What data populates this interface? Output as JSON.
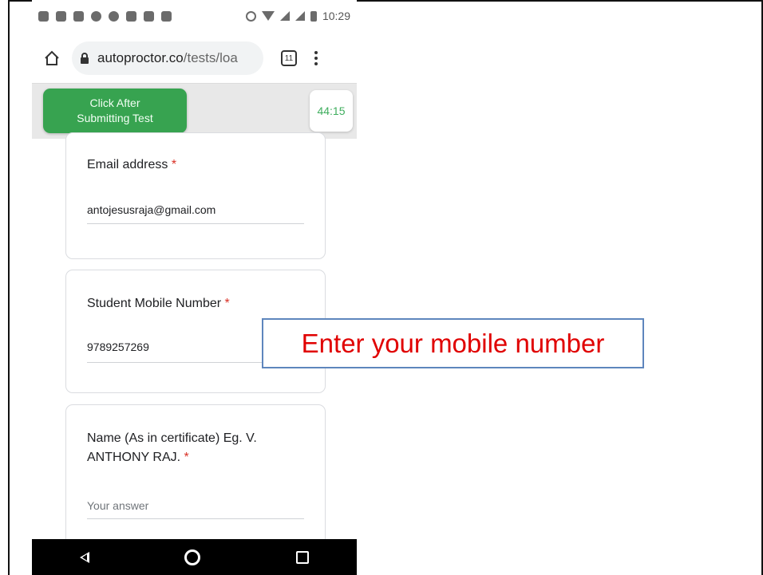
{
  "status_bar": {
    "time": "10:29"
  },
  "browser": {
    "url_host": "autoproctor.co",
    "url_path": "/tests/loa",
    "tab_count": "11"
  },
  "proctor": {
    "submit_label_line1": "Click After",
    "submit_label_line2": "Submitting Test",
    "timer": "44:15",
    "accent_color": "#37a350"
  },
  "form": {
    "fields": [
      {
        "label": "Email address",
        "required_mark": "*",
        "value": "antojesusraja@gmail.com"
      },
      {
        "label": "Student Mobile Number",
        "required_mark": "*",
        "value": "9789257269"
      },
      {
        "label_line1": "Name (As in certificate) Eg. V.",
        "label_line2": "ANTHONY RAJ.",
        "required_mark": "*",
        "placeholder": "Your answer"
      }
    ]
  },
  "callout": {
    "text": "Enter your mobile number",
    "text_color": "#e00000",
    "border_color": "#5e86bd"
  },
  "icons": {
    "home": "home-icon",
    "lock": "lock-icon",
    "tabs": "tabs-icon",
    "menu": "menu-icon",
    "back": "back-icon",
    "nav_home": "circle-icon",
    "recents": "square-icon"
  }
}
